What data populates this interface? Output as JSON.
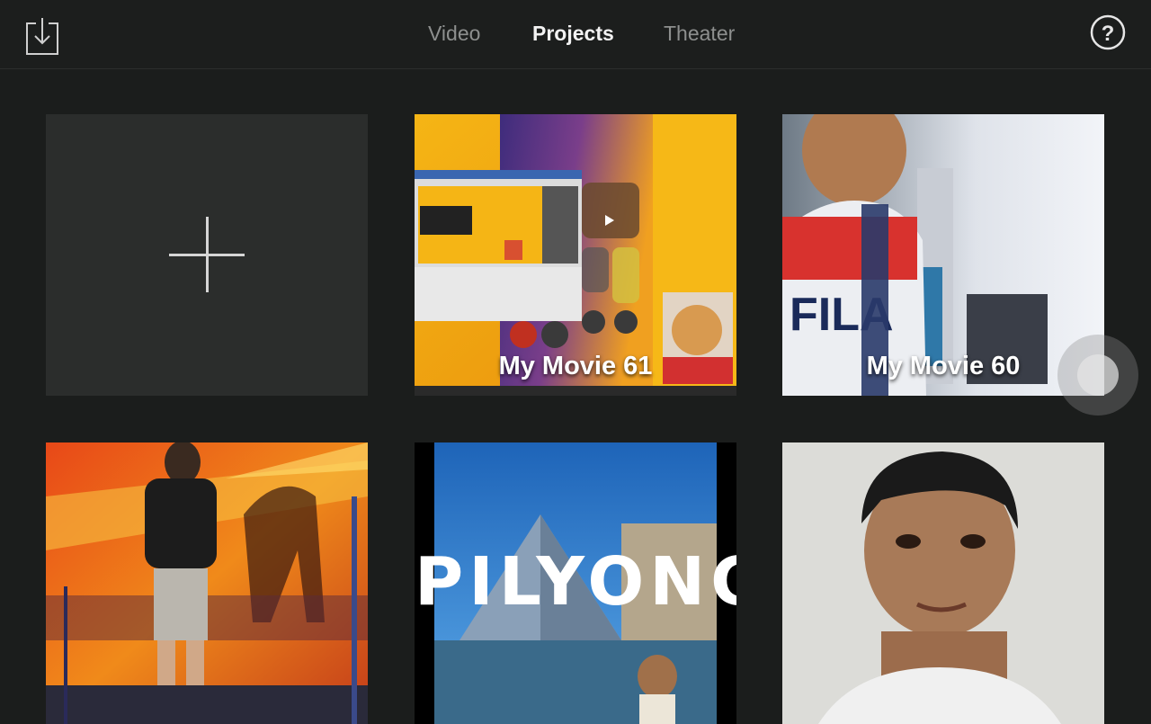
{
  "header": {
    "tabs": [
      {
        "label": "Video",
        "active": false
      },
      {
        "label": "Projects",
        "active": true
      },
      {
        "label": "Theater",
        "active": false
      }
    ],
    "import_icon": "import-download-icon",
    "help_icon": "help-question-icon",
    "help_glyph": "?"
  },
  "projects": {
    "new_project_icon": "plus-icon",
    "items": [
      {
        "title": "My Movie 61"
      },
      {
        "title": "My Movie 60"
      },
      {
        "title": ""
      },
      {
        "title": ""
      },
      {
        "title": ""
      }
    ],
    "pilyon_overlay_text": "PILYONC"
  },
  "colors": {
    "background": "#1b1d1c",
    "tab_active": "#f2f2f2",
    "tab_inactive": "#8d8f8e",
    "new_tile": "#2b2d2c"
  }
}
